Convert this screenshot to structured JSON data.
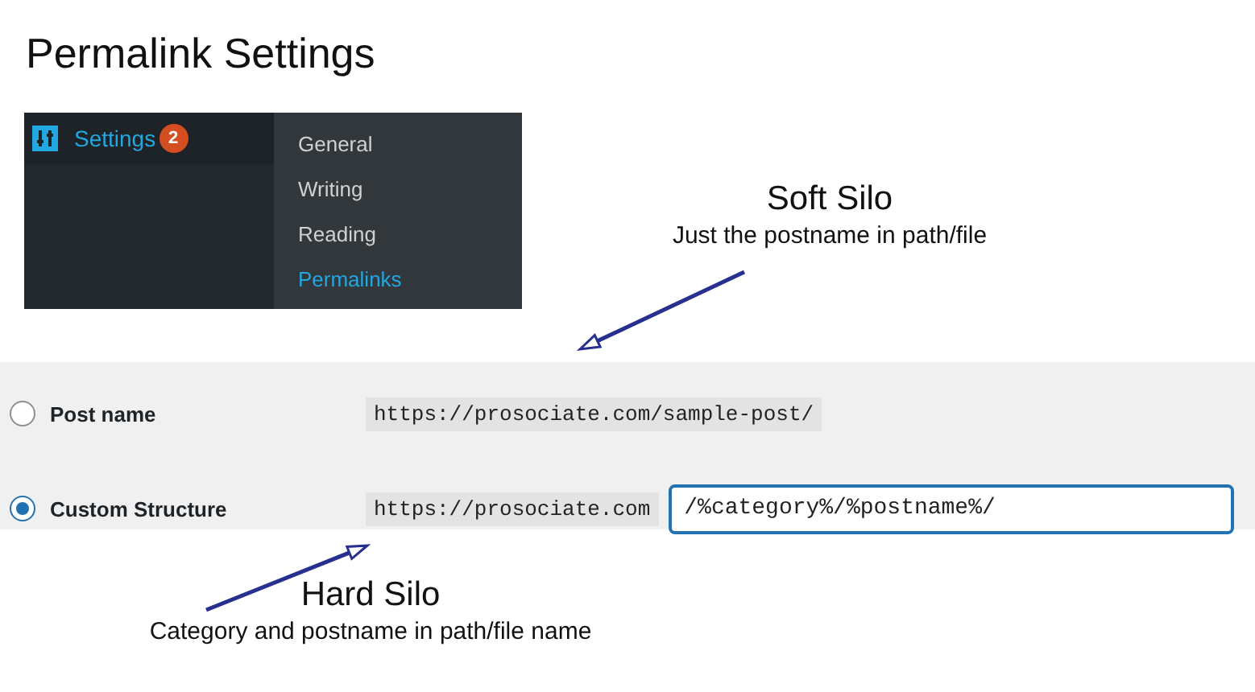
{
  "title": "Permalink Settings",
  "menu": {
    "label": "Settings",
    "badge": "2",
    "selected": true,
    "submenu": [
      {
        "label": "General",
        "selected": false
      },
      {
        "label": "Writing",
        "selected": false
      },
      {
        "label": "Reading",
        "selected": false
      },
      {
        "label": "Permalinks",
        "selected": true
      }
    ]
  },
  "annotations": [
    {
      "kind": "soft",
      "heading": "Soft Silo",
      "caption": "Just the postname in path/file"
    },
    {
      "kind": "hard",
      "heading": "Hard Silo",
      "caption": "Category and postname in path/file name"
    }
  ],
  "options": [
    {
      "kind": "example",
      "label": "Post name",
      "url": "https://prosociate.com/sample-post/",
      "selected": false
    },
    {
      "kind": "custom",
      "label": "Custom Structure",
      "url": "https://prosociate.com",
      "value": "/%category%/%postname%/",
      "selected": true
    }
  ]
}
